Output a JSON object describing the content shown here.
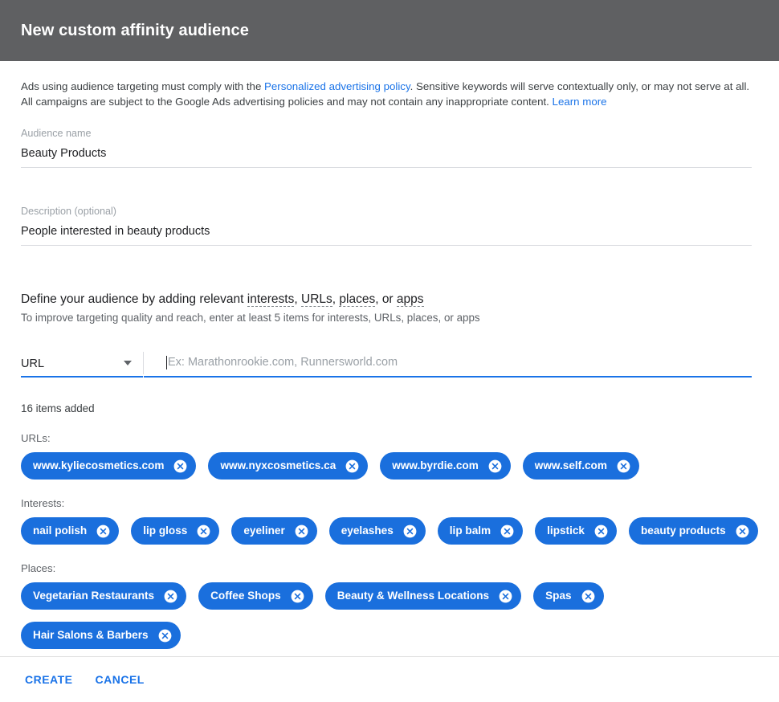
{
  "header": {
    "title": "New custom affinity audience"
  },
  "disclaimer": {
    "part1": "Ads using audience targeting must comply with the ",
    "link1": "Personalized advertising policy",
    "part2": ". Sensitive keywords will serve contextually only, or may not serve at all. All campaigns are subject to the Google Ads advertising policies and may not contain any inappropriate content. ",
    "link2": "Learn more"
  },
  "audience_name": {
    "label": "Audience name",
    "value": "Beauty Products"
  },
  "description": {
    "label": "Description (optional)",
    "value": "People interested in beauty products"
  },
  "define": {
    "heading_prefix": "Define your audience by adding relevant ",
    "term_interests": "interests",
    "sep1": ", ",
    "term_urls": "URLs",
    "sep2": ", ",
    "term_places": "places",
    "sep3": ", or ",
    "term_apps": "apps",
    "subtitle": "To improve targeting quality and reach, enter at least 5 items for interests, URLs, places, or apps"
  },
  "selector": {
    "type_value": "URL",
    "caret_icon": "chevron-down-icon",
    "entry_placeholder": "Ex: Marathonrookie.com, Runnersworld.com",
    "entry_value": ""
  },
  "items": {
    "count_text": "16 items added",
    "remove_icon": "close-circle-icon",
    "groups": [
      {
        "label": "URLs:",
        "chips": [
          "www.kyliecosmetics.com",
          "www.nyxcosmetics.ca",
          "www.byrdie.com",
          "www.self.com"
        ]
      },
      {
        "label": "Interests:",
        "chips": [
          "nail polish",
          "lip gloss",
          "eyeliner",
          "eyelashes",
          "lip balm",
          "lipstick",
          "beauty products"
        ]
      },
      {
        "label": "Places:",
        "chips": [
          "Vegetarian Restaurants",
          "Coffee Shops",
          "Beauty & Wellness Locations",
          "Spas",
          "Hair Salons & Barbers"
        ]
      }
    ]
  },
  "footer": {
    "create_label": "CREATE",
    "cancel_label": "CANCEL"
  },
  "colors": {
    "header_bg": "#5f6062",
    "accent": "#1a73e8",
    "chip_bg": "#1a6fdd",
    "divider": "#dadce0"
  }
}
